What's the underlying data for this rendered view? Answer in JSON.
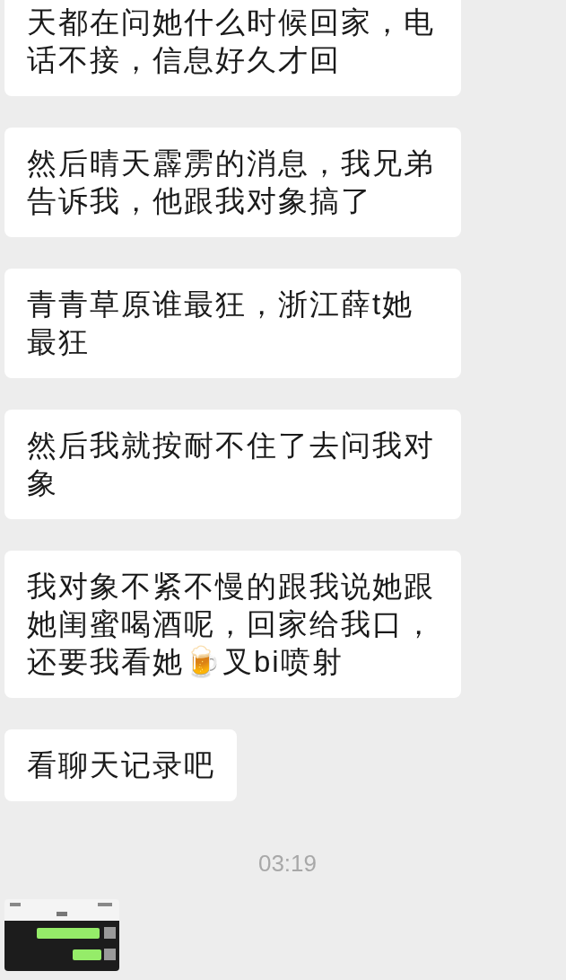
{
  "messages": [
    {
      "kind": "text",
      "text": "天都在问她什么时候回家，电话不接，信息好久才回"
    },
    {
      "kind": "text",
      "text": "然后晴天霹雳的消息，我兄弟告诉我，他跟我对象搞了"
    },
    {
      "kind": "text",
      "text": "青青草原谁最狂，浙江薛t她最狂"
    },
    {
      "kind": "text",
      "text": "然后我就按耐不住了去问我对象"
    },
    {
      "kind": "text",
      "text": "我对象不紧不慢的跟我说她跟她闺蜜喝酒呢，回家给我口，还要我看她🍺叉bi喷射"
    },
    {
      "kind": "text",
      "text": "看聊天记录吧"
    },
    {
      "kind": "time",
      "text": "03:19"
    },
    {
      "kind": "picture"
    }
  ]
}
